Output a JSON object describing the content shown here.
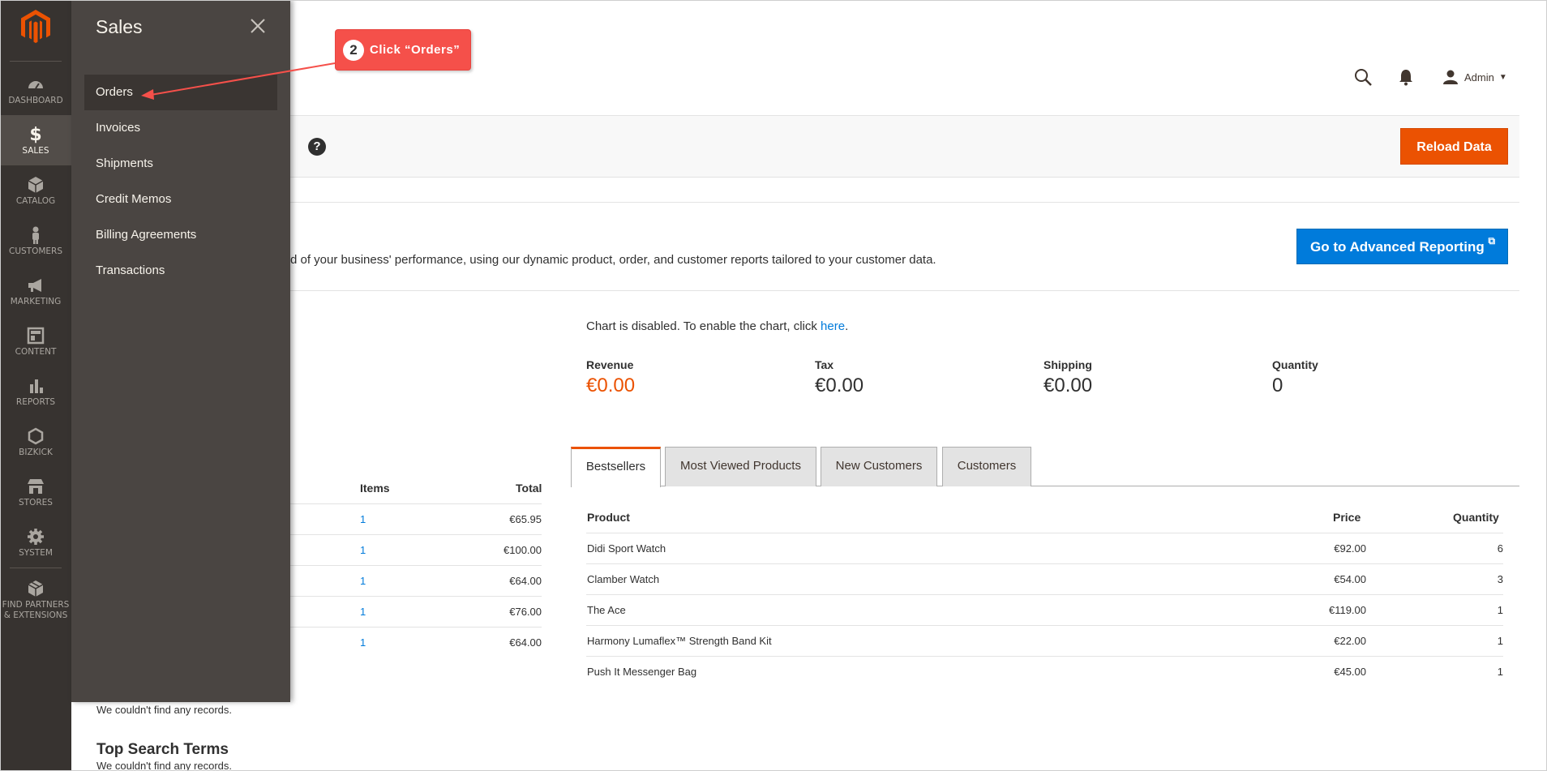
{
  "nav": {
    "items": [
      {
        "label": "DASHBOARD",
        "icon": "dashboard-icon"
      },
      {
        "label": "SALES",
        "icon": "dollar-icon"
      },
      {
        "label": "CATALOG",
        "icon": "box-icon"
      },
      {
        "label": "CUSTOMERS",
        "icon": "person-icon"
      },
      {
        "label": "MARKETING",
        "icon": "megaphone-icon"
      },
      {
        "label": "CONTENT",
        "icon": "layout-icon"
      },
      {
        "label": "REPORTS",
        "icon": "bar-chart-icon"
      },
      {
        "label": "BIZKICK",
        "icon": "hexagon-icon"
      },
      {
        "label": "STORES",
        "icon": "store-icon"
      },
      {
        "label": "SYSTEM",
        "icon": "gear-icon"
      },
      {
        "label": "FIND PARTNERS",
        "label2": "& EXTENSIONS",
        "icon": "extensions-icon"
      }
    ],
    "active": "SALES"
  },
  "flyout": {
    "title": "Sales",
    "items": [
      "Orders",
      "Invoices",
      "Shipments",
      "Credit Memos",
      "Billing Agreements",
      "Transactions"
    ],
    "active": "Orders"
  },
  "header": {
    "account_name": "Admin"
  },
  "toolbar": {
    "reload_label": "Reload Data"
  },
  "advanced": {
    "description": "d of your business' performance, using our dynamic product, order, and customer reports tailored to your customer data.",
    "button_label": "Go to Advanced Reporting"
  },
  "chart": {
    "message": "Chart is disabled. To enable the chart, click ",
    "link": "here",
    "link_suffix": "."
  },
  "totals": [
    {
      "label": "Revenue",
      "value": "€0.00"
    },
    {
      "label": "Tax",
      "value": "€0.00"
    },
    {
      "label": "Shipping",
      "value": "€0.00"
    },
    {
      "label": "Quantity",
      "value": "0"
    }
  ],
  "last_orders": {
    "headers": {
      "items": "Items",
      "total": "Total"
    },
    "rows": [
      {
        "items": "1",
        "total": "€65.95"
      },
      {
        "items": "1",
        "total": "€100.00"
      },
      {
        "items": "1",
        "total": "€64.00"
      },
      {
        "items": "1",
        "total": "€76.00"
      },
      {
        "items": "1",
        "total": "€64.00"
      }
    ]
  },
  "last_search": {
    "empty": "We couldn't find any records."
  },
  "top_search": {
    "title": "Top Search Terms",
    "empty": "We couldn't find any records."
  },
  "tabs": [
    "Bestsellers",
    "Most Viewed Products",
    "New Customers",
    "Customers"
  ],
  "active_tab": "Bestsellers",
  "bestsellers": {
    "headers": {
      "product": "Product",
      "price": "Price",
      "quantity": "Quantity"
    },
    "rows": [
      {
        "product": "Didi Sport Watch",
        "price": "€92.00",
        "quantity": "6"
      },
      {
        "product": "Clamber Watch",
        "price": "€54.00",
        "quantity": "3"
      },
      {
        "product": "The Ace",
        "price": "€119.00",
        "quantity": "1"
      },
      {
        "product": "Harmony Lumaflex™ Strength Band Kit",
        "price": "€22.00",
        "quantity": "1"
      },
      {
        "product": "Push It Messenger Bag",
        "price": "€45.00",
        "quantity": "1"
      }
    ]
  },
  "callout": {
    "step": "2",
    "text": "Click “Orders”"
  },
  "colors": {
    "nav_bg": "#373330",
    "flyout_bg": "#4a4542",
    "accent_orange": "#eb5202",
    "link_blue": "#007bdb",
    "callout_red": "#f5504a"
  }
}
